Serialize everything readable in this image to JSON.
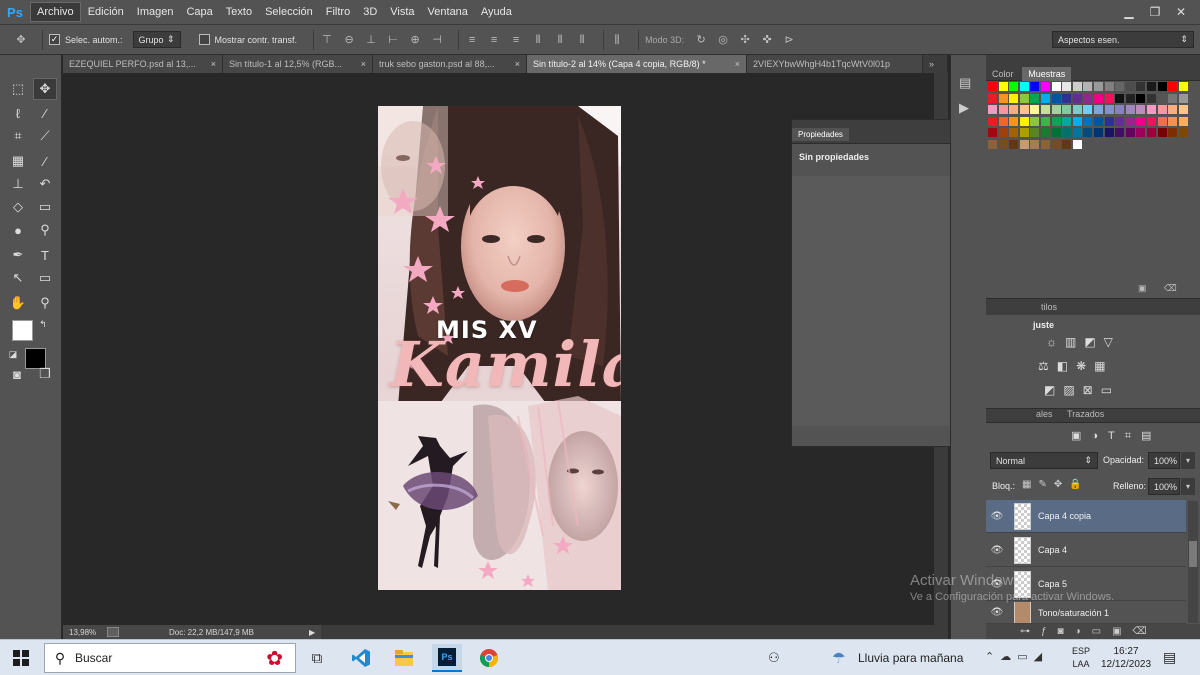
{
  "app": {
    "logo": "Ps",
    "menu": [
      "Archivo",
      "Edición",
      "Imagen",
      "Capa",
      "Texto",
      "Selección",
      "Filtro",
      "3D",
      "Vista",
      "Ventana",
      "Ayuda"
    ],
    "window_buttons": {
      "minimize": "▁",
      "restore": "❐",
      "close": "✕"
    }
  },
  "options": {
    "auto_select_label": "Selec. autom.:",
    "auto_select_value": "Grupo",
    "show_transform_label": "Mostrar contr. transf.",
    "mode3d_label": "Modo 3D:",
    "workspace": "Aspectos esen."
  },
  "tabs": [
    {
      "label": "EZEQUIEL PERFO.psd al 13,...",
      "close": "×"
    },
    {
      "label": "Sin título-1 al 12,5% (RGB...",
      "close": "×"
    },
    {
      "label": "truk sebo gaston.psd al 88,...",
      "close": "×"
    },
    {
      "label": "Sin título-2 al 14% (Capa 4 copia, RGB/8) *",
      "close": "×"
    },
    {
      "label": "2VIEXYbwWhgH4b1TqcWtV0l01p",
      "close": ""
    }
  ],
  "tabs_overflow": "»",
  "artwork": {
    "title_small": "MIS XV",
    "title_big": "Kamila"
  },
  "status": {
    "zoom": "13,98%",
    "doc": "Doc: 22,2 MB/147,9 MB"
  },
  "properties": {
    "tab": "Propiedades",
    "message": "Sin propiedades"
  },
  "color_panel": {
    "tabs": [
      "Color",
      "Muestras"
    ],
    "swatches_row1": [
      "#ff0000",
      "#ffff00",
      "#00ff00",
      "#00ffff",
      "#0000ff",
      "#ff00ff",
      "#ffffff",
      "#e6e6e6",
      "#cccccc",
      "#b3b3b3",
      "#999999",
      "#808080",
      "#666666",
      "#4d4d4d",
      "#333333",
      "#1a1a1a",
      "#000000",
      "#ff0000",
      "#ffff00"
    ],
    "swatches_row2": [
      "#ed1c24",
      "#f7941d",
      "#fff200",
      "#8dc63f",
      "#00a651",
      "#00aeef",
      "#0054a6",
      "#2e3192",
      "#662d91",
      "#92278f",
      "#ec008c",
      "#ed145b",
      "#111111",
      "#222222",
      "#000000",
      "#333333",
      "#555555",
      "#777777",
      "#999999"
    ],
    "swatches_row3": [
      "#f49ac1",
      "#f5989d",
      "#f9ad81",
      "#fdc689",
      "#fff799",
      "#c4df9b",
      "#a3d39c",
      "#82ca9c",
      "#7accc8",
      "#6dcff6",
      "#7da7d9",
      "#8393ca",
      "#8781bd",
      "#a186be",
      "#bd8cbf",
      "#f49ac2",
      "#f6989d",
      "#f9ad81",
      "#fdc689"
    ],
    "swatches_row4": [
      "#ed1c24",
      "#f26522",
      "#f7941d",
      "#fff200",
      "#8dc73f",
      "#39b54a",
      "#00a651",
      "#00a99d",
      "#00aeef",
      "#0072bc",
      "#0054a6",
      "#2e3192",
      "#662d91",
      "#92278f",
      "#ec008c",
      "#ed145b",
      "#f26c4f",
      "#f68e56",
      "#fbaf5d"
    ],
    "swatches_row5": [
      "#9e0b0f",
      "#a0410d",
      "#a36209",
      "#aba000",
      "#598527",
      "#197b30",
      "#007236",
      "#00746b",
      "#0076a3",
      "#004b80",
      "#003471",
      "#1b1464",
      "#440e62",
      "#630460",
      "#9e005d",
      "#9e0039",
      "#790000",
      "#7b2e00",
      "#7d4900"
    ],
    "swatches_row6": [
      "#8c6239",
      "#754c24",
      "#603913",
      "#c69c6d",
      "#a67c52",
      "#8c6239",
      "#754c24",
      "#603913",
      "#ffffff"
    ]
  },
  "adjust_panel": {
    "tab_partial": "tilos",
    "title_partial": "juste"
  },
  "layers": {
    "tabs_partial": [
      "ales",
      "Trazados"
    ],
    "blend_mode": "Normal",
    "opacity_label": "Opacidad:",
    "opacity_value": "100%",
    "lock_label": "Bloq.:",
    "fill_label": "Relleno:",
    "fill_value": "100%",
    "items": [
      {
        "name": "Capa 4 copia"
      },
      {
        "name": "Capa 4"
      },
      {
        "name": "Capa 5"
      },
      {
        "name": "Tono/saturación 1"
      }
    ]
  },
  "watermark": {
    "line1": "Activar Windows",
    "line2": "Ve a Configuración para activar Windows."
  },
  "taskbar": {
    "search": "Buscar",
    "weather": "Lluvia para mañana",
    "lang1": "ESP",
    "lang2": "LAA",
    "time": "16:27",
    "date": "12/12/2023"
  },
  "colors": {
    "ps_blue": "#31a8ff",
    "pink_title": "#f1b7b9",
    "selected_layer": "#5a6b86"
  }
}
